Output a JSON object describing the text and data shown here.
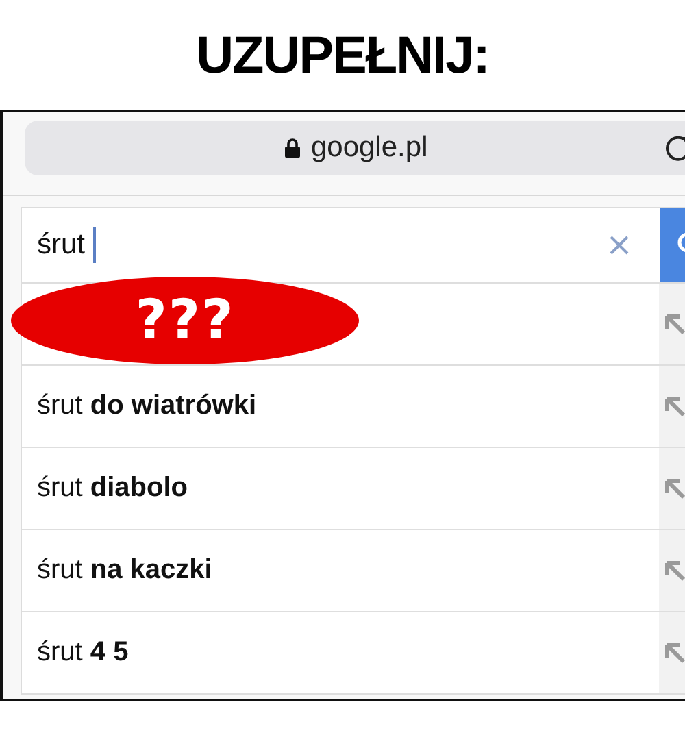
{
  "heading": "UZUPEŁNIJ:",
  "address_bar": {
    "url": "google.pl"
  },
  "search": {
    "value": "śrut"
  },
  "covered_suggestion": {
    "overlay": "???"
  },
  "suggestions": [
    {
      "text": "śrut **do wiatrówki**"
    },
    {
      "text": "śrut **diabolo**"
    },
    {
      "text": "śrut **na kaczki**"
    },
    {
      "text": "śrut **4 5**"
    }
  ]
}
